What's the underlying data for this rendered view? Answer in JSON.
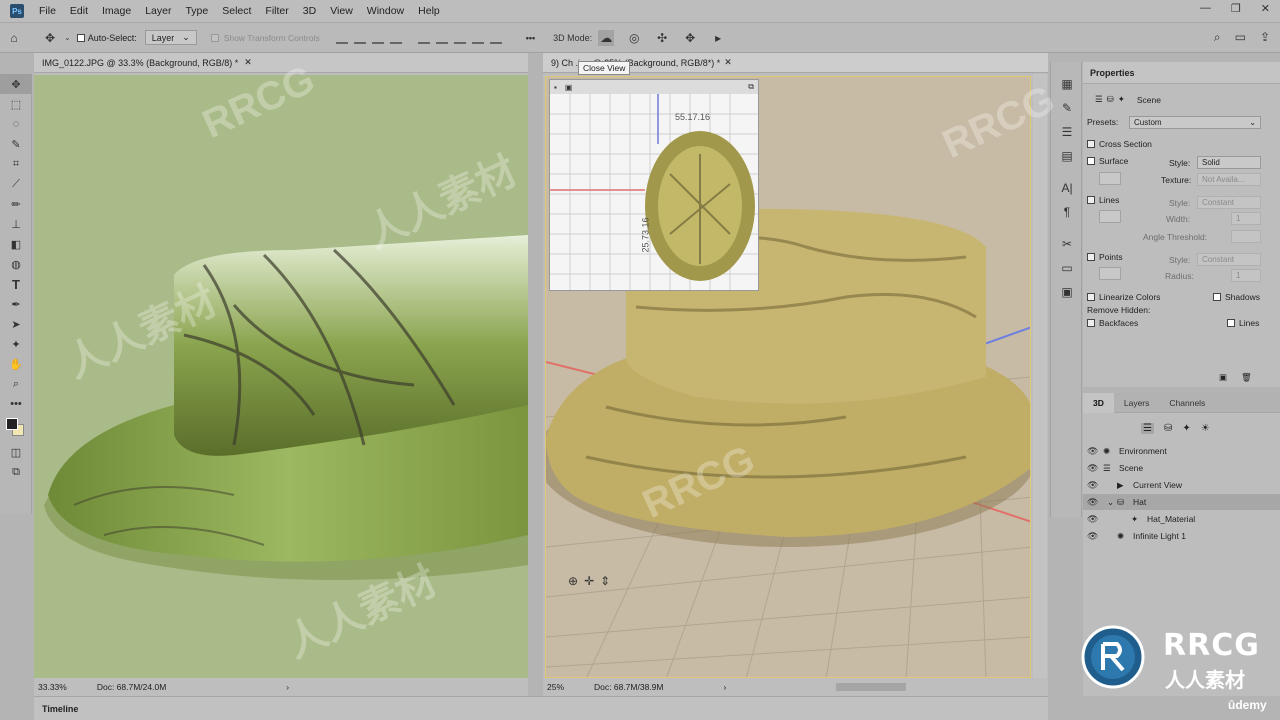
{
  "app_logo": "Ps",
  "menu": [
    "File",
    "Edit",
    "Image",
    "Layer",
    "Type",
    "Select",
    "Filter",
    "3D",
    "View",
    "Window",
    "Help"
  ],
  "options": {
    "auto_select_label": "Auto-Select:",
    "auto_select_value": "Layer",
    "show_transform_label": "Show Transform Controls",
    "mode_label": "3D Mode:",
    "more": "•••"
  },
  "doc1": {
    "tab": "IMG_0122.JPG @ 33.3% (Background, RGB/8) *",
    "zoom": "33.33%",
    "doc_size": "Doc: 68.7M/24.0M"
  },
  "doc2": {
    "tab": "9) Ch                .jpg @ 25% (Background, RGB/8*) *",
    "zoom": "25%",
    "doc_size": "Doc: 68.7M/38.9M",
    "tooltip": "Close View",
    "minimap_labels": [
      "55.17.16",
      "25.73.16"
    ]
  },
  "properties": {
    "title": "Properties",
    "scene_label": "Scene",
    "presets_label": "Presets:",
    "presets_value": "Custom",
    "cross_section": "Cross Section",
    "surface": "Surface",
    "style_label": "Style:",
    "surface_style": "Solid",
    "texture_label": "Texture:",
    "texture_value": "Not Availa...",
    "lines": "Lines",
    "lines_style": "Constant",
    "width_label": "Width:",
    "width_value": "1",
    "angle_label": "Angle Threshold:",
    "points": "Points",
    "points_style": "Constant",
    "radius_label": "Radius:",
    "radius_value": "1",
    "linearize": "Linearize Colors",
    "shadows": "Shadows",
    "remove_hidden": "Remove Hidden:",
    "backfaces": "Backfaces",
    "lines2": "Lines"
  },
  "panel3d": {
    "tabs": [
      "3D",
      "Layers",
      "Channels"
    ],
    "items": [
      "Environment",
      "Scene",
      "Current View",
      "Hat",
      "Hat_Material",
      "Infinite Light 1"
    ]
  },
  "timeline": "Timeline",
  "brand": {
    "name": "RRCG",
    "sub": "人人素材"
  },
  "watermark": [
    "RRCG",
    "人人素材"
  ],
  "udemy": "ūdemy",
  "icons": {
    "move": "move-icon",
    "marquee": "marquee-icon",
    "lasso": "lasso-icon",
    "quick_select": "quick-select-icon",
    "crop": "crop-icon",
    "eyedropper": "eyedropper-icon",
    "brush": "brush-icon",
    "stamp": "stamp-icon",
    "eraser": "eraser-icon",
    "text": "type-icon",
    "pen": "pen-icon",
    "path_select": "path-select-icon",
    "hand": "hand-icon",
    "zoom": "zoom-icon"
  }
}
